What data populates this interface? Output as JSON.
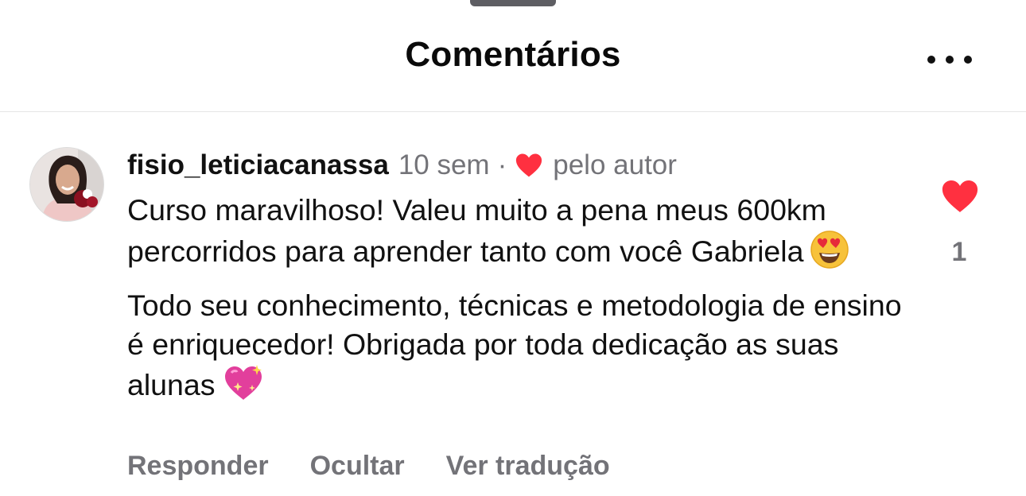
{
  "header": {
    "title": "Comentários",
    "more_icon": "more-horizontal-icon"
  },
  "comment": {
    "username": "fisio_leticiacanassa",
    "time": "10 sem",
    "separator": "·",
    "liked_by_author_icon": "heart-icon",
    "liked_by_author_text": "pelo autor",
    "paragraph1": "Curso maravilhoso! Valeu muito a pena meus 600km percorridos para aprender tanto com você Gabriela",
    "paragraph1_emoji": "heart-eyes-emoji",
    "paragraph2": "Todo seu conhecimento, técnicas e metodologia de ensino é enriquecedor! Obrigada por toda dedicação as suas alunas",
    "paragraph2_emoji": "sparkling-heart-emoji",
    "like_icon": "heart-icon",
    "like_count": "1",
    "accent_color": "#ff3040"
  },
  "actions": {
    "reply": "Responder",
    "hide": "Ocultar",
    "translate": "Ver tradução"
  }
}
